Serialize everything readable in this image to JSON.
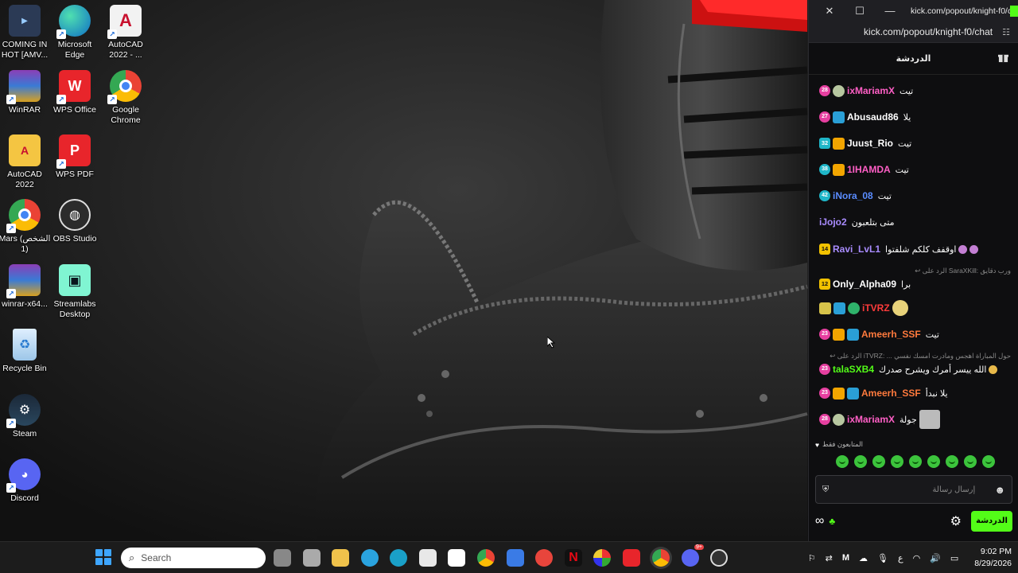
{
  "desktop": {
    "icons": [
      {
        "label": "COMING IN HOT [AMV...",
        "icon": "video-file-icon"
      },
      {
        "label": "Microsoft Edge",
        "icon": "edge-icon"
      },
      {
        "label": "AutoCAD 2022 - ...",
        "icon": "autocad-icon"
      },
      {
        "label": "WinRAR",
        "icon": "winrar-icon"
      },
      {
        "label": "WPS Office",
        "icon": "wps-office-icon"
      },
      {
        "label": "Google Chrome",
        "icon": "chrome-icon"
      },
      {
        "label": "AutoCAD 2022",
        "icon": "autocad-folder-icon"
      },
      {
        "label": "WPS PDF",
        "icon": "wps-pdf-icon"
      },
      {
        "label": "Mars (الشخص 1)",
        "icon": "chrome-profile-icon"
      },
      {
        "label": "OBS Studio",
        "icon": "obs-icon"
      },
      {
        "label": "winrar-x64...",
        "icon": "winrar-installer-icon"
      },
      {
        "label": "Streamlabs Desktop",
        "icon": "streamlabs-icon"
      },
      {
        "label": "Recycle Bin",
        "icon": "recycle-bin-icon"
      },
      {
        "label": "Steam",
        "icon": "steam-icon"
      },
      {
        "label": "Discord",
        "icon": "discord-icon"
      }
    ]
  },
  "chat_window": {
    "tab_title": "kick.com/popout/knight-f0/c...",
    "url": "kick.com/popout/knight-f0/chat",
    "header_title": "الدردشة",
    "messages": [
      {
        "badge": "28",
        "badge_color": "#e63fa0",
        "user": "ixMariamX",
        "user_color": "#ff5fc6",
        "text": "تيت"
      },
      {
        "badge": "27",
        "badge_color": "#e63fa0",
        "user": "Abusaud86",
        "user_color": "#ffffff",
        "text": "يلا"
      },
      {
        "badge": "32",
        "badge_color": "#1fb6c8",
        "user": "Juust_Rio",
        "user_color": "#ffffff",
        "text": "تيت"
      },
      {
        "badge": "38",
        "badge_color": "#1fb6c8",
        "user": "1IHAMDA",
        "user_color": "#ff5fc6",
        "text": "تيت"
      },
      {
        "badge": "42",
        "badge_color": "#1fb6c8",
        "user": "iNora_08",
        "user_color": "#5a8cff",
        "text": "تيت"
      },
      {
        "badge": "",
        "badge_color": "",
        "user": "iJojo2",
        "user_color": "#a98cff",
        "text": "متى بتلعبون"
      },
      {
        "badge": "14",
        "badge_color": "#f2c200",
        "user": "Ravi_LvL1",
        "user_color": "#a98cff",
        "text": "اوقفف كلكم شلفتوا"
      },
      {
        "badge": "12",
        "badge_color": "#f2c200",
        "user": "Only_Alpha09",
        "user_color": "#ffffff",
        "text": "برا"
      },
      {
        "badge": "",
        "badge_color": "",
        "user": "iTVRZ",
        "user_color": "#ff3b3b",
        "text": ""
      },
      {
        "badge": "23",
        "badge_color": "#e63fa0",
        "user": "Ameerh_SSF",
        "user_color": "#ff7a3d",
        "text": "تيت"
      },
      {
        "badge": "23",
        "badge_color": "#e63fa0",
        "user": "talaSXB4",
        "user_color": "#53fc18",
        "text": "الله ييسر أمرك ويشرح صدرك"
      },
      {
        "badge": "23",
        "badge_color": "#e63fa0",
        "user": "Ameerh_SSF",
        "user_color": "#ff7a3d",
        "text": "يلا نبدأ"
      },
      {
        "badge": "28",
        "badge_color": "#e63fa0",
        "user": "ixMariamX",
        "user_color": "#ff5fc6",
        "text": "جولة"
      }
    ],
    "reply_1": "↩ الرد على SaraXKill: ورب دقايق",
    "reply_2": "↩ الرد على iTVRZ: ... حول المباراة اهجس ومادرت امسك نفسي",
    "followers_only": "المتابعون فقط",
    "input_placeholder": "إرسال رسالة",
    "send_button": "الدردشة"
  },
  "taskbar": {
    "search_placeholder": "Search",
    "time": "9:02 PM",
    "date": "8/29/2026",
    "discord_badge": "9+",
    "lang": "ع"
  }
}
